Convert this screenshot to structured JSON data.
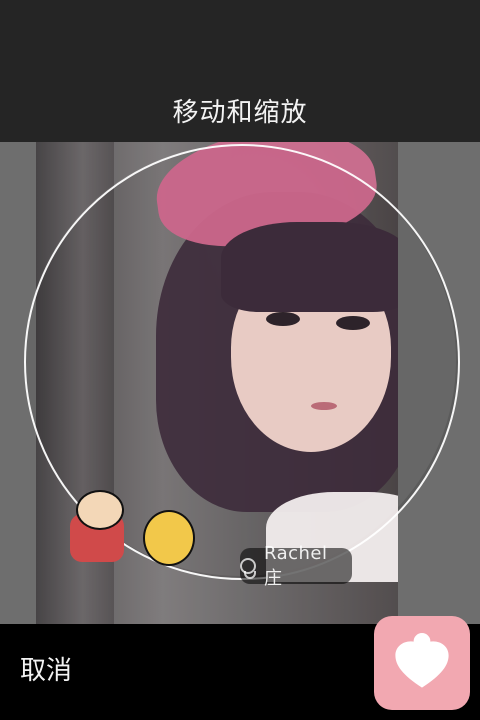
{
  "header": {
    "title": "移动和缩放"
  },
  "photo": {
    "watermark_name": "Rachel 庄"
  },
  "footer": {
    "cancel_label": "取消"
  },
  "app_badge": {
    "icon": "heart-person-icon",
    "accent_color": "#f2a8b1"
  }
}
